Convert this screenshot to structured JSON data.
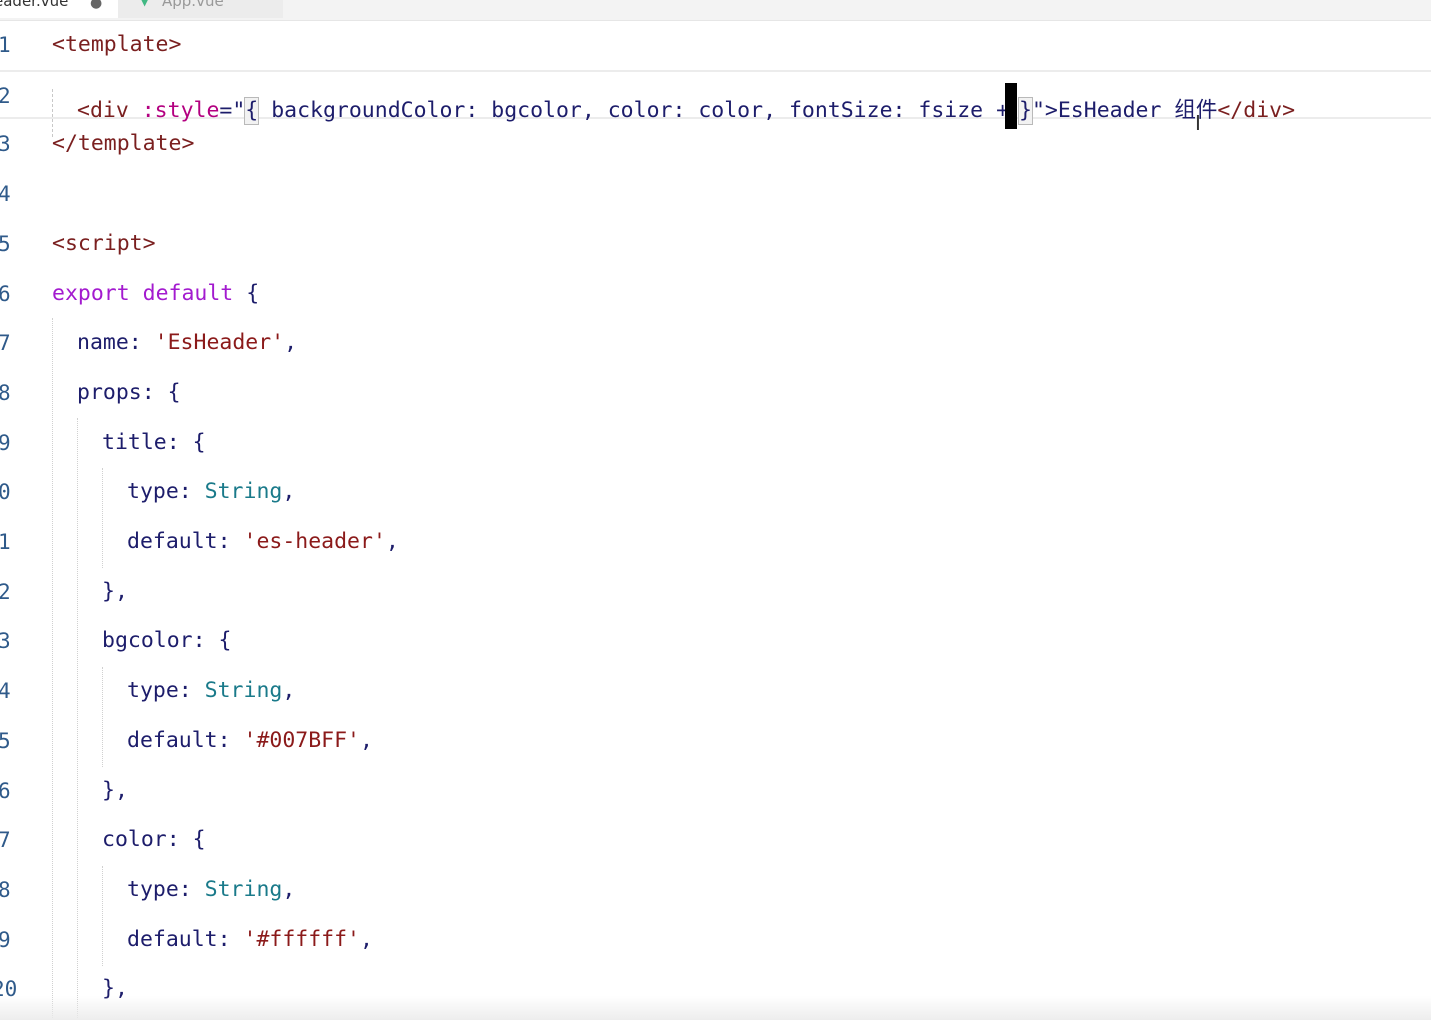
{
  "tabs": [
    {
      "label": "eader.vue",
      "dirty_marker": "●",
      "active": true
    },
    {
      "label": "App.vue",
      "icon": "vue-icon",
      "active": false
    }
  ],
  "code": {
    "lines": [
      {
        "num": "1"
      },
      {
        "num": "2"
      },
      {
        "num": "3"
      },
      {
        "num": "4"
      },
      {
        "num": "5"
      },
      {
        "num": "6"
      },
      {
        "num": "7"
      },
      {
        "num": "8"
      },
      {
        "num": "9"
      },
      {
        "num": "0"
      },
      {
        "num": "1"
      },
      {
        "num": "2"
      },
      {
        "num": "3"
      },
      {
        "num": "4"
      },
      {
        "num": "5"
      },
      {
        "num": "6"
      },
      {
        "num": "7"
      },
      {
        "num": "8"
      },
      {
        "num": "9"
      },
      {
        "num": "20"
      }
    ],
    "l1": {
      "tag": "<template>"
    },
    "l2": {
      "open": "<div ",
      "attr": ":style",
      "eq": "=\"",
      "lbrace": "{",
      "body": " backgroundColor: bgcolor, color: color, fontSize: fsize +",
      "rbrace": "}",
      "close_quote": "\">",
      "text": "EsHeader 组件",
      "end_tag": "</div>"
    },
    "l3": {
      "tag": "</template>"
    },
    "l5": {
      "tag": "<script>"
    },
    "l6": {
      "kw1": "export",
      "kw2": "default",
      "brace": "{"
    },
    "l7": {
      "key": "name: ",
      "str": "'EsHeader'",
      "tail": ","
    },
    "l8": {
      "key": "props: {"
    },
    "l9": {
      "key": "title: {"
    },
    "l10": {
      "key": "type: ",
      "type": "String",
      "tail": ","
    },
    "l11": {
      "key": "default: ",
      "str": "'es-header'",
      "tail": ","
    },
    "l12": {
      "key": "},"
    },
    "l13": {
      "key": "bgcolor: {"
    },
    "l14": {
      "key": "type: ",
      "type": "String",
      "tail": ","
    },
    "l15": {
      "key": "default: ",
      "str": "'#007BFF'",
      "tail": ","
    },
    "l16": {
      "key": "},"
    },
    "l17": {
      "key": "color: {"
    },
    "l18": {
      "key": "type: ",
      "type": "String",
      "tail": ","
    },
    "l19": {
      "key": "default: ",
      "str": "'#ffffff'",
      "tail": ","
    },
    "l20": {
      "key": "},"
    }
  },
  "colors": {
    "tag": "#7a1f1f",
    "attr": "#b30080",
    "keyword": "#a31acf",
    "string": "#8b1a1a",
    "type": "#1a7a8a",
    "identifier": "#1d1d6b",
    "line_number": "#2f5a8a"
  }
}
